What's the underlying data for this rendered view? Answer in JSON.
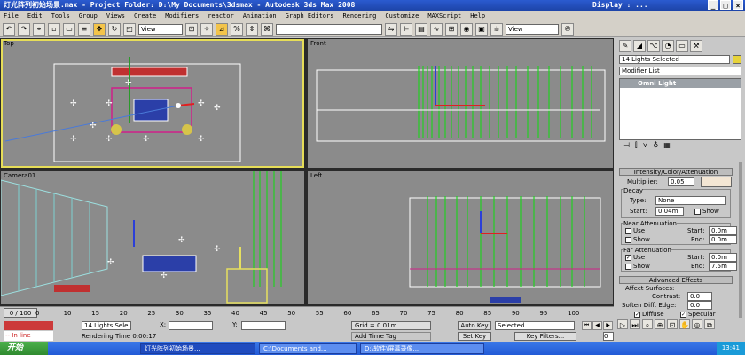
{
  "window": {
    "title": "灯光阵列初始场景.max    - Project Folder: D:\\My Documents\\3dsmax    - Autodesk 3ds Max 2008",
    "display_label": "Display : ..."
  },
  "menu": [
    "File",
    "Edit",
    "Tools",
    "Group",
    "Views",
    "Create",
    "Modifiers",
    "reactor",
    "Animation",
    "Graph Editors",
    "Rendering",
    "Customize",
    "MAXScript",
    "Help"
  ],
  "toolbar": {
    "view_dropdown": "View",
    "view_dropdown_right": "View"
  },
  "viewports": {
    "top": "Top",
    "front": "Front",
    "camera": "Camera01",
    "left": "Left"
  },
  "command_panel": {
    "selection_name": "14 Lights Selected",
    "modifier_list": "Modifier List",
    "stack_item": "Omni Light",
    "rollout_intensity": "Intensity/Color/Attenuation",
    "multiplier_label": "Multiplier:",
    "multiplier_value": "0.05",
    "decay_label": "Decay",
    "type_label": "Type:",
    "type_value": "None",
    "start_label": "Start:",
    "start_value": "0.04m",
    "show_label": "Show",
    "near_atten_label": "Near Attenuation",
    "use_label": "Use",
    "start2_label": "Start:",
    "near_start_value": "0.0m",
    "show2_label": "Show",
    "end_label": "End:",
    "near_end_value": "0.0m",
    "far_atten_label": "Far Attenuation",
    "use2_label": "Use",
    "start3_label": "Start:",
    "far_start_value": "0.0m",
    "show3_label": "Show",
    "end2_label": "End:",
    "far_end_value": "7.5m",
    "rollout_advanced": "Advanced Effects",
    "affect_surfaces_label": "Affect Surfaces:",
    "contrast_label": "Contrast:",
    "contrast_value": "0.0",
    "soften_label": "Soften Diff. Edge:",
    "soften_value": "0.0",
    "diffuse_label": "Diffuse",
    "specular_label": "Specular"
  },
  "timeline": {
    "frame_counter": "0 / 100",
    "ticks": [
      "0",
      "10",
      "15",
      "20",
      "25",
      "30",
      "35",
      "40",
      "45",
      "50",
      "55",
      "60",
      "65",
      "70",
      "75",
      "80",
      "85",
      "90",
      "95",
      "100"
    ]
  },
  "status": {
    "selection_count": "14 Lights Sele",
    "x_label": "X:",
    "y_label": "Y:",
    "grid_label": "Grid = 0.01m",
    "rendering_time": "Rendering Time  0:00:17",
    "add_time_tag": "Add Time Tag",
    "auto_key": "Auto Key",
    "set_key": "Set Key",
    "selected_dropdown": "Selected",
    "key_filters": "Key Filters...",
    "frame_field": "0",
    "in_line": "-- In line"
  },
  "taskbar": {
    "start_label": "开始",
    "tasks": [
      "灯光阵列初始场景...",
      "C:\\Documents and...",
      "D:\\软件\\屏幕录像..."
    ],
    "clock": "13:41"
  }
}
